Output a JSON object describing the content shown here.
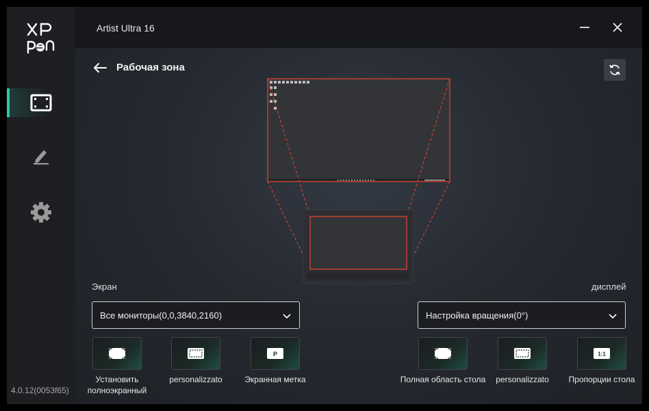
{
  "app": {
    "title": "Artist Ultra 16",
    "version": "4.0.12(0053f65)"
  },
  "sidebar": {
    "items": [
      {
        "name": "work-area",
        "icon": "screen-frame-icon",
        "active": true
      },
      {
        "name": "pen",
        "icon": "pen-icon",
        "active": false
      },
      {
        "name": "settings",
        "icon": "gear-icon",
        "active": false
      }
    ]
  },
  "header": {
    "back_icon": "arrow-left-icon",
    "page_title": "Рабочая зона",
    "refresh_icon": "refresh-icon"
  },
  "screen_section": {
    "label": "Экран",
    "dropdown_value": "Все мониторы(0,0,3840,2160)",
    "options": [
      {
        "label": "Установить полноэкранный",
        "icon": "fullscreen-icon"
      },
      {
        "label": "personalizzato",
        "icon": "custom-area-icon"
      },
      {
        "label": "Экранная метка",
        "icon": "p-mark-icon"
      }
    ]
  },
  "display_section": {
    "label": "дисплей",
    "dropdown_value": "Настройка вращения(0°)",
    "options": [
      {
        "label": "Полная область стола",
        "icon": "fullscreen-icon"
      },
      {
        "label": "personalizzato",
        "icon": "custom-area-icon"
      },
      {
        "label": "Пропорции стола",
        "icon": "ratio-icon"
      }
    ]
  },
  "icons": {
    "ratio_text": "1:1",
    "p_text": "P"
  },
  "colors": {
    "accent": "#2fc7a6",
    "highlight": "#e8452e"
  }
}
